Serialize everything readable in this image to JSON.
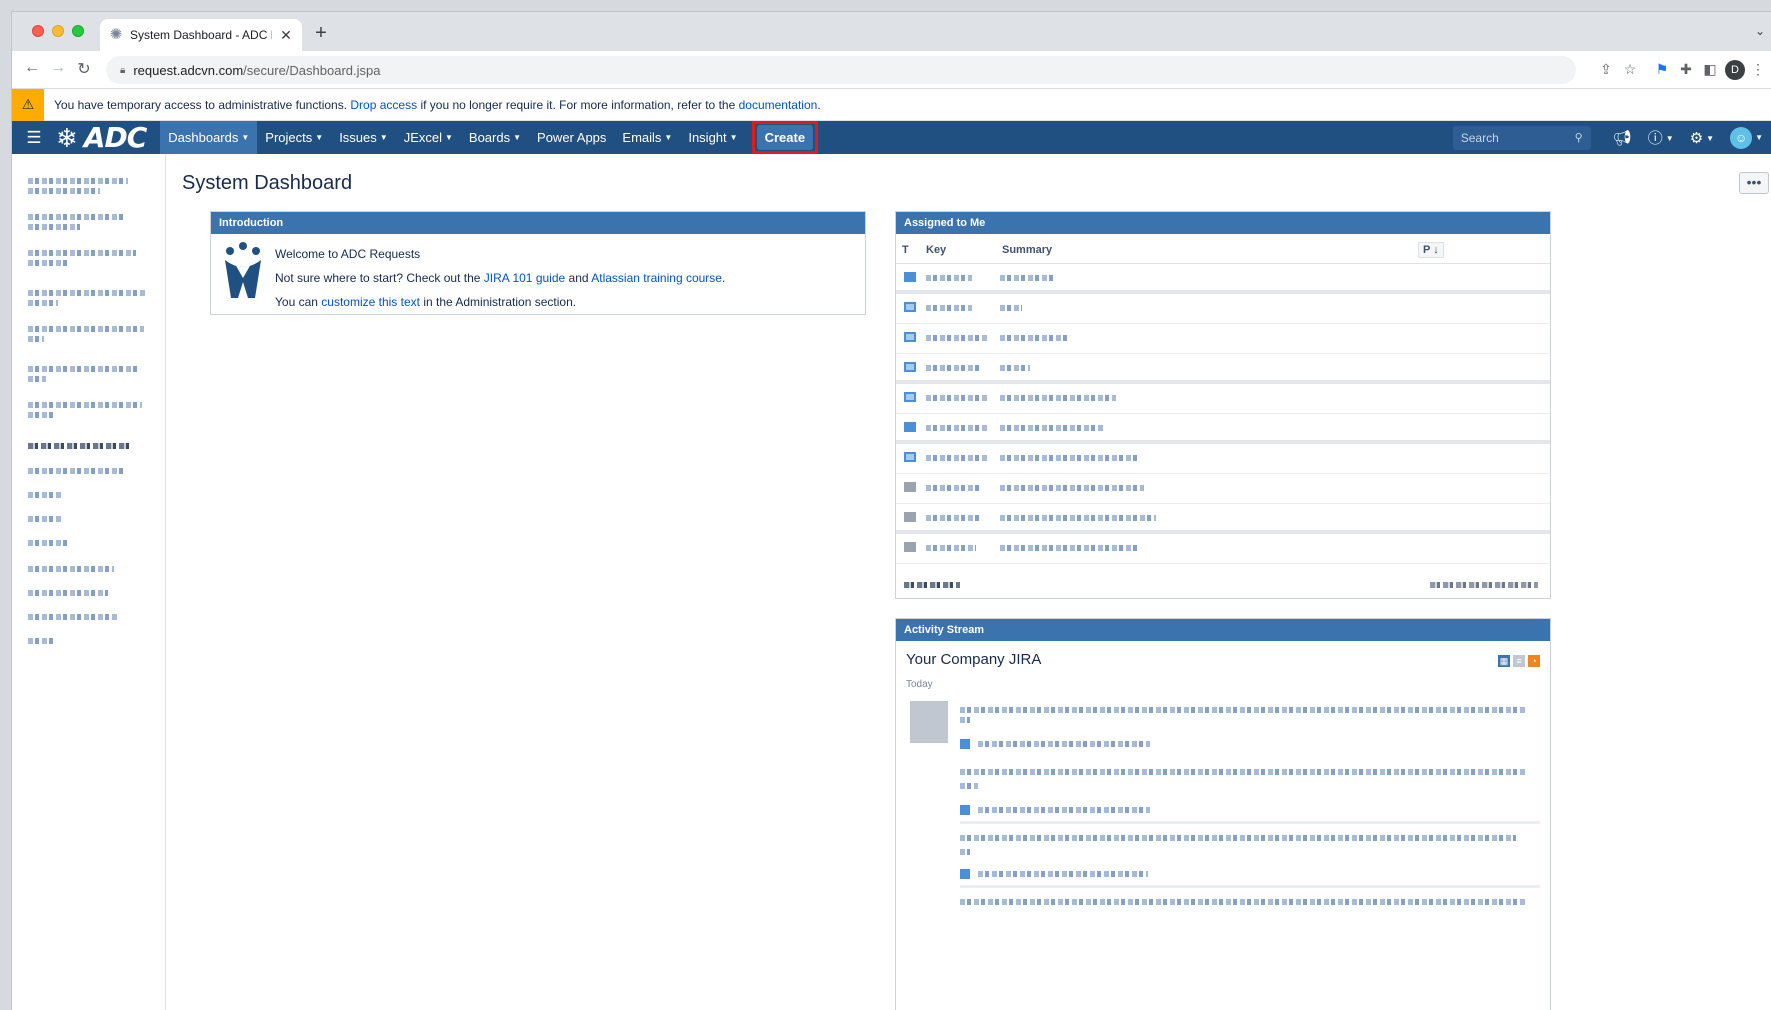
{
  "browser": {
    "tab_title": "System Dashboard - ADC Requ",
    "url_host": "request.adcvn.com",
    "url_path": "/secure/Dashboard.jspa",
    "profile_initial": "D"
  },
  "warning": {
    "text_before": "You have temporary access to administrative functions.",
    "drop_link": "Drop access",
    "text_middle": "if you no longer require it. For more information, refer to the",
    "doc_link": "documentation",
    "text_after": "."
  },
  "header": {
    "logo_text": "ADC",
    "menu": [
      {
        "label": "Dashboards",
        "has_caret": true
      },
      {
        "label": "Projects",
        "has_caret": true
      },
      {
        "label": "Issues",
        "has_caret": true
      },
      {
        "label": "JExcel",
        "has_caret": true
      },
      {
        "label": "Boards",
        "has_caret": true
      },
      {
        "label": "Power Apps",
        "has_caret": false
      },
      {
        "label": "Emails",
        "has_caret": true
      },
      {
        "label": "Insight",
        "has_caret": true
      }
    ],
    "create_label": "Create",
    "search_placeholder": "Search",
    "colors": {
      "header_bg": "#205081",
      "active_bg": "#3b73af",
      "highlight": "#e01b1b"
    }
  },
  "page": {
    "title": "System Dashboard",
    "more_button": "•••"
  },
  "intro": {
    "heading": "Introduction",
    "welcome": "Welcome to ADC Requests",
    "line2_before": "Not sure where to start? Check out the",
    "line2_link1": "JIRA 101 guide",
    "line2_and": "and",
    "line2_link2": "Atlassian training course",
    "line2_after": ".",
    "line3_before": "You can",
    "line3_link": "customize this text",
    "line3_after": "in the Administration section."
  },
  "assigned": {
    "heading": "Assigned to Me",
    "columns": {
      "type": "T",
      "key": "Key",
      "summary": "Summary",
      "priority": "P ↓"
    }
  },
  "activity": {
    "heading": "Activity Stream",
    "title": "Your Company JIRA",
    "today": "Today"
  }
}
